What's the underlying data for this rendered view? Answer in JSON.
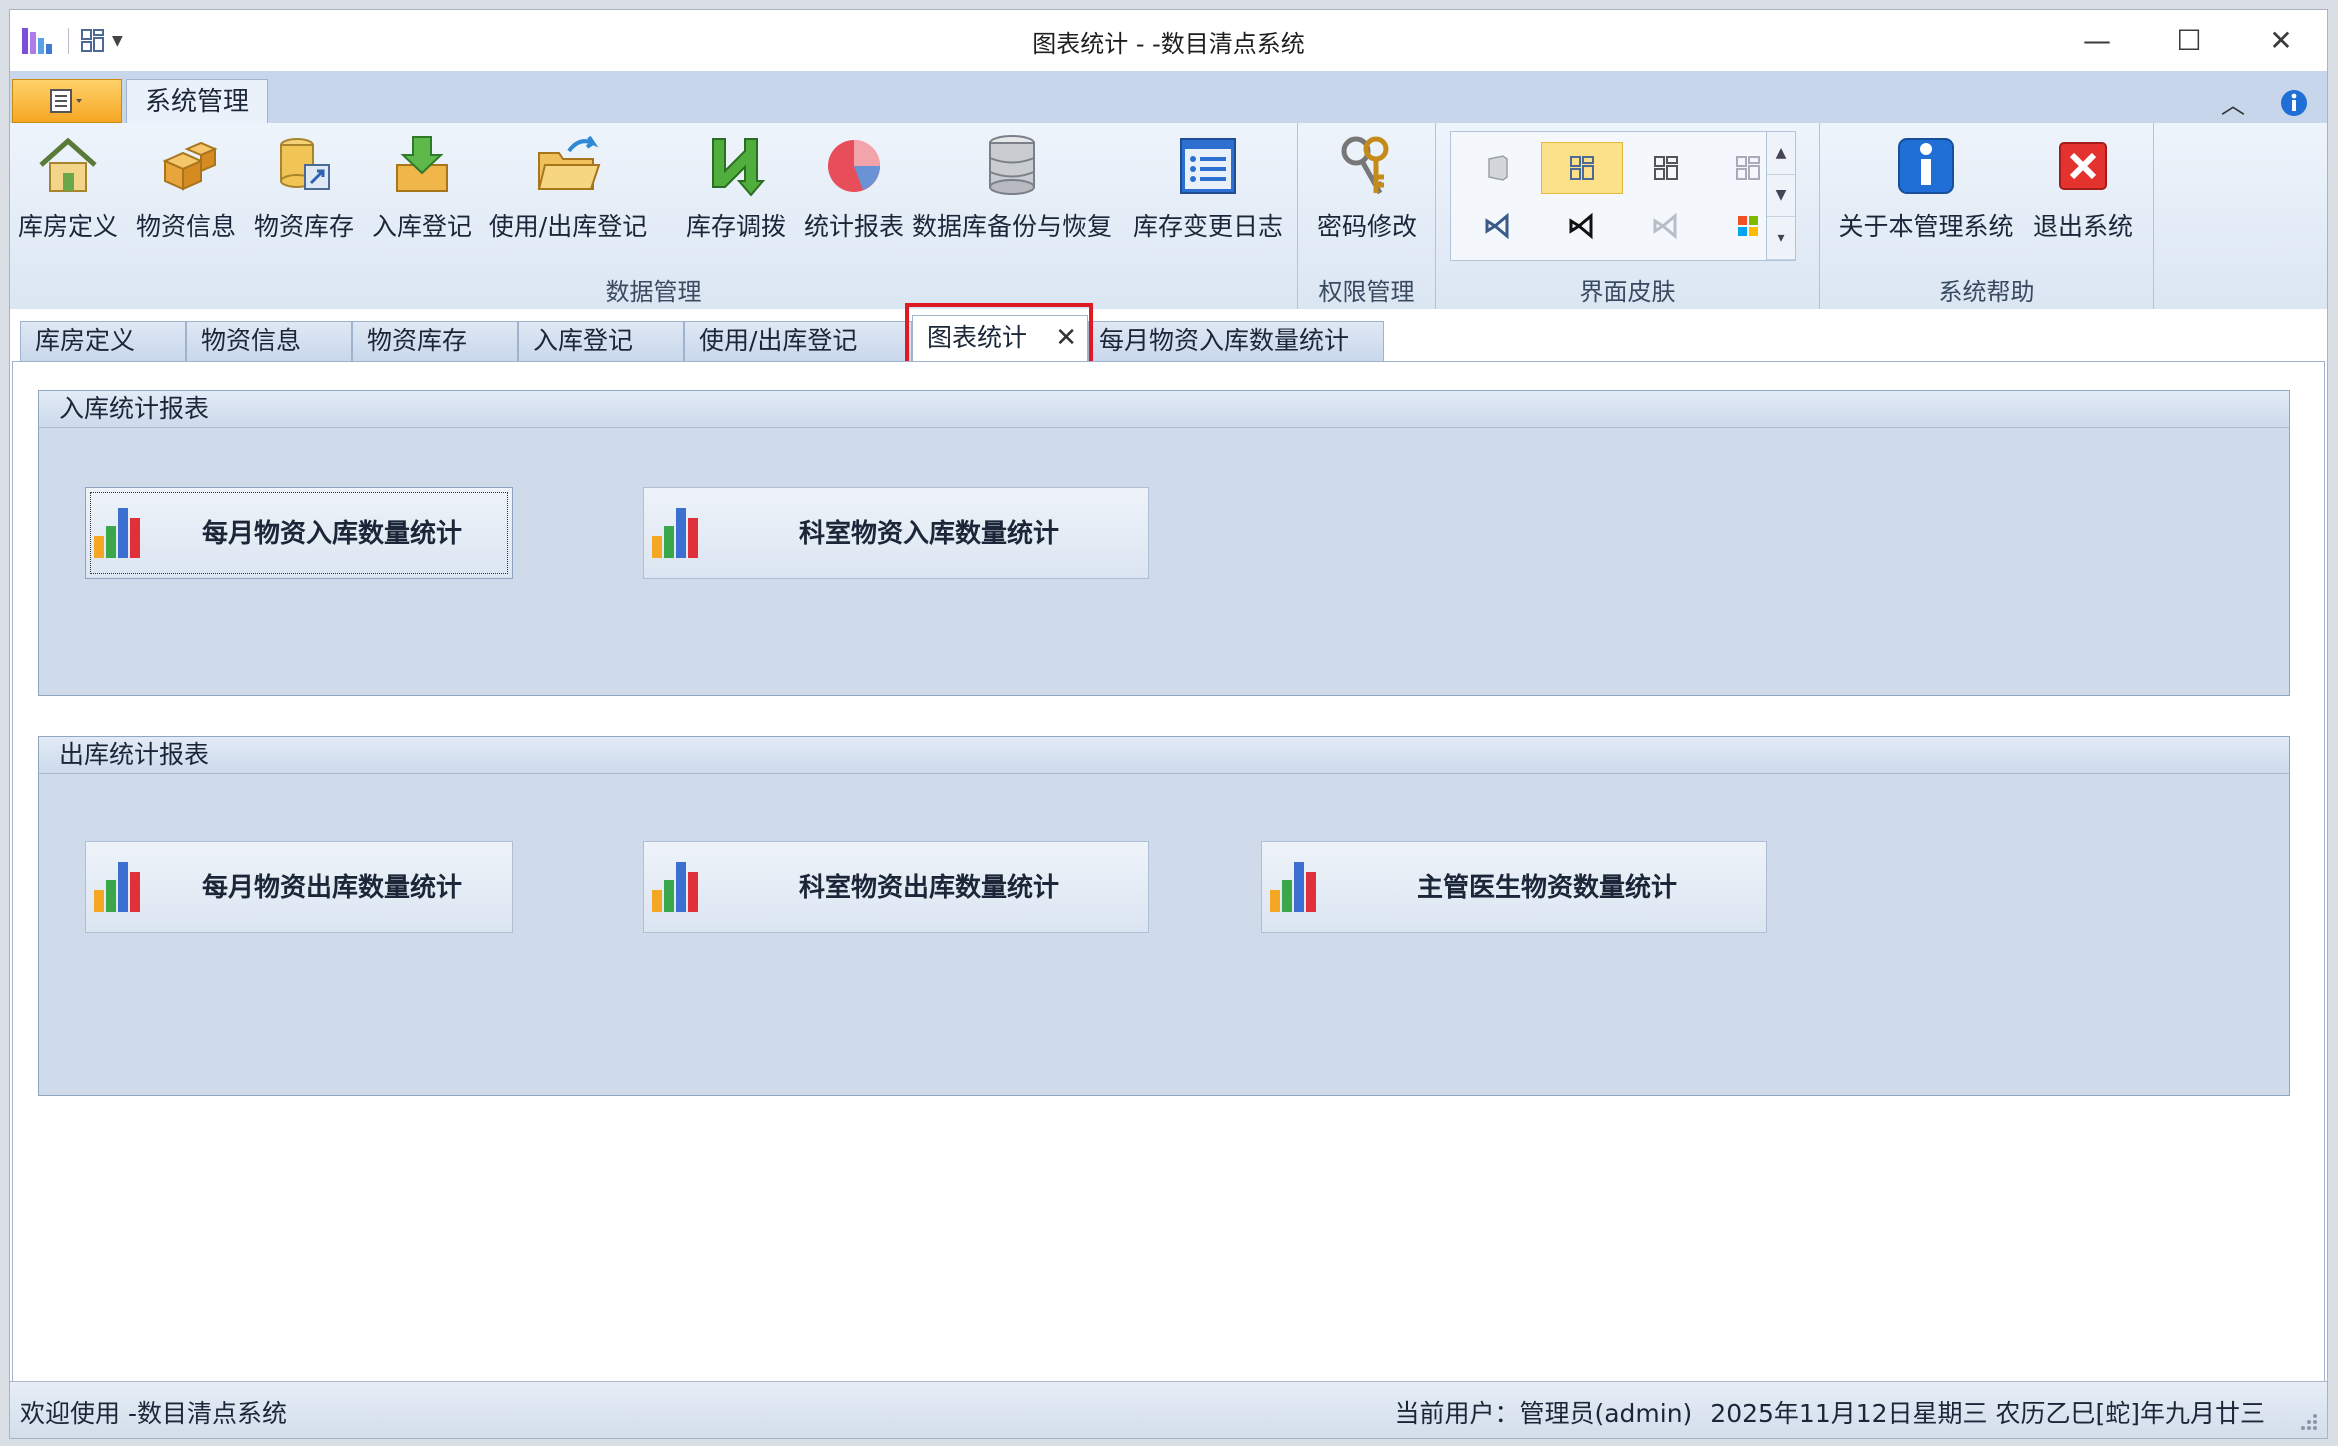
{
  "window": {
    "title": "图表统计 - -数目清点系统"
  },
  "ribbon_tabs": {
    "active": "系统管理"
  },
  "ribbon": {
    "groups": [
      {
        "label": "数据管理",
        "buttons": [
          "库房定义",
          "物资信息",
          "物资库存",
          "入库登记",
          "使用/出库登记",
          "库存调拨",
          "统计报表",
          "数据库备份与恢复",
          "库存变更日志"
        ]
      },
      {
        "label": "权限管理",
        "buttons": [
          "密码修改"
        ]
      },
      {
        "label": "界面皮肤",
        "buttons": []
      },
      {
        "label": "系统帮助",
        "buttons": [
          "关于本管理系统",
          "退出系统"
        ]
      }
    ]
  },
  "doc_tabs": [
    "库房定义",
    "物资信息",
    "物资库存",
    "入库登记",
    "使用/出库登记",
    "图表统计",
    "每月物资入库数量统计"
  ],
  "active_doc_tab": "图表统计",
  "panels": {
    "inbound": {
      "title": "入库统计报表",
      "buttons": [
        "每月物资入库数量统计",
        "科室物资入库数量统计"
      ]
    },
    "outbound": {
      "title": "出库统计报表",
      "buttons": [
        "每月物资出库数量统计",
        "科室物资出库数量统计",
        "主管医生物资数量统计"
      ]
    }
  },
  "status": {
    "welcome": "欢迎使用 -数目清点系统",
    "user": "当前用户：管理员(admin)",
    "date": "2025年11月12日星期三 农历乙巳[蛇]年九月廿三"
  },
  "colors": {
    "accent_red": "#e01a22",
    "ribbon_blue": "#c7d6ea",
    "panel_blue": "#cfdbeb"
  }
}
